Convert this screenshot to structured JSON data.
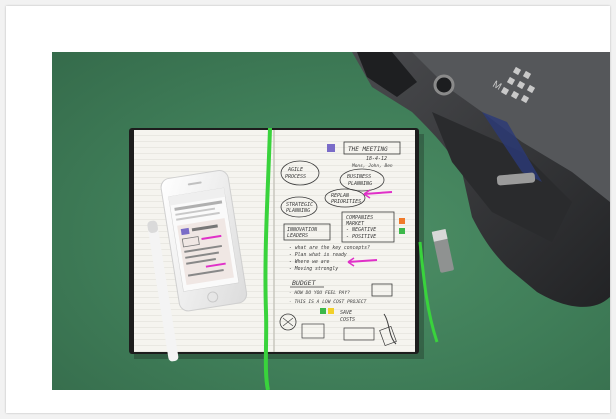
{
  "image": {
    "colors": {
      "background": "#3f7d58",
      "page": "#f5f4ef",
      "ribbon": "#39d33c",
      "bag": "#2f3032",
      "phone": "#f7f7f7",
      "ink": "#3a3a3a",
      "highlight": "#e030c8"
    },
    "handwriting": {
      "title_box": "THE MEETING",
      "date": "18-4-12",
      "names": "Mons, John, Ben",
      "bubble_1_l1": "AGILE",
      "bubble_1_l2": "PROCESS",
      "bubble_2_l1": "BUSINESS",
      "bubble_2_l2": "PLANNING",
      "bubble_3": "STRATEGIC",
      "bubble_3b": "PLANNING",
      "bubble_4": "REPLAN",
      "bubble_4b": "PRIORITIES",
      "box_1_l1": "INNOVATION",
      "box_1_l2": "LEADERS",
      "box_2_l1": "COMPANIES",
      "box_2_l2": "MARKET",
      "box_2_l3": "- NEGATIVE",
      "box_2_l4": "- POSITIVE",
      "note_1": "- what are the key concepts?",
      "note_2": "- Plan what is ready",
      "note_3": "- Where we are",
      "note_4": "- Moving strongly",
      "heading_2": "BUDGET",
      "note_5": "- HOW DO YOU FEEL PAY?",
      "note_6": "- THIS IS A LOW COST PROJECT",
      "note_7": "SAVE",
      "note_8": "COSTS"
    }
  }
}
